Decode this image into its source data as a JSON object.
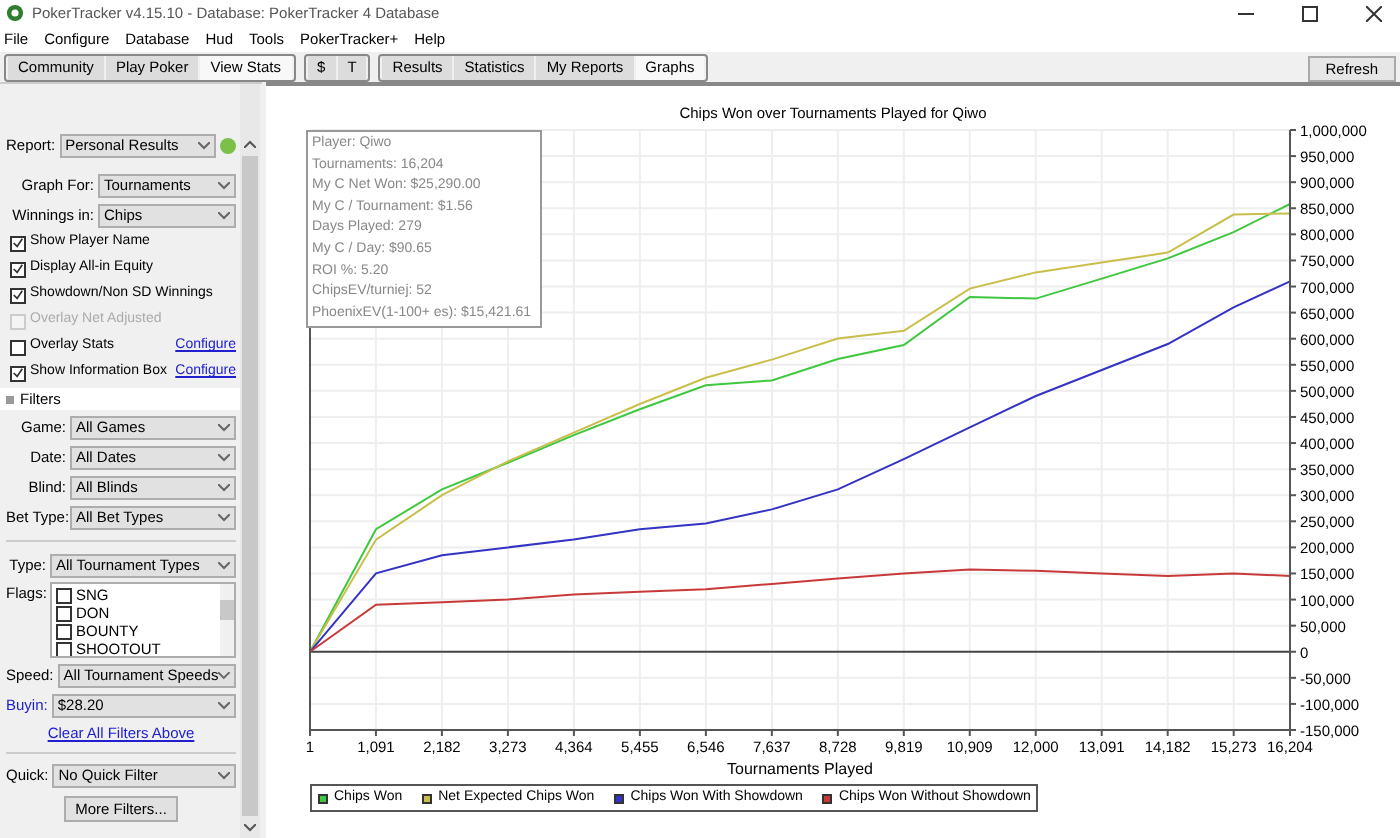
{
  "window": {
    "title": "PokerTracker v4.15.10 - Database: PokerTracker 4 Database"
  },
  "menu": [
    "File",
    "Configure",
    "Database",
    "Hud",
    "Tools",
    "PokerTracker+",
    "Help"
  ],
  "toolbar": {
    "groups": [
      [
        {
          "label": "Community",
          "selected": false
        },
        {
          "label": "Play Poker",
          "selected": false
        },
        {
          "label": "View Stats",
          "selected": true
        }
      ],
      [
        {
          "label": "$",
          "selected": false
        },
        {
          "label": "T",
          "selected": false
        }
      ],
      [
        {
          "label": "Results",
          "selected": false
        },
        {
          "label": "Statistics",
          "selected": false
        },
        {
          "label": "My Reports",
          "selected": false
        },
        {
          "label": "Graphs",
          "selected": true
        }
      ]
    ],
    "refresh": "Refresh"
  },
  "left_panel": {
    "selects": [
      {
        "label": "Report:",
        "value": "Personal Results"
      },
      {
        "label": "Graph For:",
        "value": "Tournaments"
      },
      {
        "label": "Winnings in:",
        "value": "Chips"
      }
    ],
    "options": [
      {
        "label": "Show Player Name",
        "checked": true,
        "disabled": false
      },
      {
        "label": "Display All-in Equity",
        "checked": true,
        "disabled": false
      },
      {
        "label": "Showdown/Non SD Winnings",
        "checked": true,
        "disabled": false
      },
      {
        "label": "Overlay Net Adjusted",
        "checked": false,
        "disabled": true
      },
      {
        "label": "Overlay Stats",
        "checked": false,
        "disabled": false,
        "link": "Configure"
      },
      {
        "label": "Show Information Box",
        "checked": true,
        "disabled": false,
        "link": "Configure"
      }
    ],
    "filters_header": "Filters",
    "filters": [
      {
        "label": "Game:",
        "value": "All Games"
      },
      {
        "label": "Date:",
        "value": "All Dates"
      },
      {
        "label": "Blind:",
        "value": "All Blinds"
      },
      {
        "label": "Bet Type:",
        "value": "All Bet Types"
      }
    ],
    "type": {
      "label": "Type:",
      "value": "All Tournament Types"
    },
    "flags": {
      "label": "Flags:",
      "items": [
        {
          "label": "SNG",
          "checked": false
        },
        {
          "label": "DON",
          "checked": false
        },
        {
          "label": "BOUNTY",
          "checked": false
        },
        {
          "label": "SHOOTOUT",
          "checked": false
        }
      ]
    },
    "more_selects": [
      {
        "label": "Speed:",
        "value": "All Tournament Speeds",
        "label_is_link": false
      },
      {
        "label": "Buyin:",
        "value": "$28.20",
        "label_is_link": true
      }
    ],
    "clear_link": "Clear All Filters Above",
    "quick": {
      "label": "Quick:",
      "value": "No Quick Filter"
    },
    "more_button": "More Filters..."
  },
  "chart": {
    "info_box": [
      "Player: Qiwo",
      "Tournaments: 16,204",
      "My C Net Won: $25,290.00",
      "My C / Tournament: $1.56",
      "Days Played: 279",
      "My C / Day: $90.65",
      "ROI %: 5.20",
      "ChipsEV/turniej: 52",
      "PhoenixEV(1-100+ es): $15,421.61"
    ],
    "chart_data": {
      "type": "line",
      "title": "Chips Won over Tournaments Played for  Qiwo",
      "xlabel": "Tournaments Played",
      "x": [
        1,
        1091,
        2182,
        3273,
        4364,
        5455,
        6546,
        7637,
        8728,
        9819,
        10909,
        12000,
        13091,
        14182,
        15273,
        16204
      ],
      "series": [
        {
          "name": "Chips Won",
          "color": "#3fc83f",
          "values": [
            0,
            235000,
            311000,
            362000,
            415000,
            465000,
            511000,
            520000,
            561000,
            588000,
            680000,
            677000,
            715000,
            754000,
            804000,
            858000
          ]
        },
        {
          "name": "Net Expected Chips Won",
          "color": "#c8bf4a",
          "values": [
            0,
            215000,
            300000,
            365000,
            420000,
            475000,
            525000,
            560000,
            600000,
            615000,
            696000,
            727000,
            746000,
            765000,
            838000,
            840000
          ]
        },
        {
          "name": "Chips Won With Showdown",
          "color": "#3333c4",
          "values": [
            0,
            150000,
            185000,
            200000,
            215000,
            235000,
            246000,
            273000,
            311000,
            369000,
            430000,
            490000,
            540000,
            590000,
            660000,
            710000
          ]
        },
        {
          "name": "Chips Won Without Showdown",
          "color": "#c83a3a",
          "values": [
            0,
            90000,
            95000,
            100000,
            110000,
            115000,
            120000,
            130000,
            140000,
            150000,
            158000,
            155000,
            150000,
            145000,
            150000,
            145000
          ]
        }
      ],
      "grid": true,
      "xlim": [
        1,
        16204
      ],
      "ylim": [
        -150000,
        1000000
      ],
      "xticks": [
        {
          "value": 1,
          "label": "1"
        },
        {
          "value": 1091,
          "label": "1,091"
        },
        {
          "value": 2182,
          "label": "2,182"
        },
        {
          "value": 3273,
          "label": "3,273"
        },
        {
          "value": 4364,
          "label": "4,364"
        },
        {
          "value": 5455,
          "label": "5,455"
        },
        {
          "value": 6546,
          "label": "6,546"
        },
        {
          "value": 7637,
          "label": "7,637"
        },
        {
          "value": 8728,
          "label": "8,728"
        },
        {
          "value": 9819,
          "label": "9,819"
        },
        {
          "value": 10909,
          "label": "10,909"
        },
        {
          "value": 12000,
          "label": "12,000"
        },
        {
          "value": 13091,
          "label": "13,091"
        },
        {
          "value": 14182,
          "label": "14,182"
        },
        {
          "value": 15273,
          "label": "15,273"
        },
        {
          "value": 16204,
          "label": "16,204"
        }
      ],
      "yticks": [
        {
          "value": 1000000,
          "label": "1,000,000"
        },
        {
          "value": 950000,
          "label": "950,000"
        },
        {
          "value": 900000,
          "label": "900,000"
        },
        {
          "value": 850000,
          "label": "850,000"
        },
        {
          "value": 800000,
          "label": "800,000"
        },
        {
          "value": 750000,
          "label": "750,000"
        },
        {
          "value": 700000,
          "label": "700,000"
        },
        {
          "value": 650000,
          "label": "650,000"
        },
        {
          "value": 600000,
          "label": "600,000"
        },
        {
          "value": 550000,
          "label": "550,000"
        },
        {
          "value": 500000,
          "label": "500,000"
        },
        {
          "value": 450000,
          "label": "450,000"
        },
        {
          "value": 400000,
          "label": "400,000"
        },
        {
          "value": 350000,
          "label": "350,000"
        },
        {
          "value": 300000,
          "label": "300,000"
        },
        {
          "value": 250000,
          "label": "250,000"
        },
        {
          "value": 200000,
          "label": "200,000"
        },
        {
          "value": 150000,
          "label": "150,000"
        },
        {
          "value": 100000,
          "label": "100,000"
        },
        {
          "value": 50000,
          "label": "50,000"
        },
        {
          "value": 0,
          "label": "0"
        },
        {
          "value": -50000,
          "label": "-50,000"
        },
        {
          "value": -100000,
          "label": "-100,000"
        },
        {
          "value": -150000,
          "label": "-150,000"
        }
      ]
    }
  }
}
